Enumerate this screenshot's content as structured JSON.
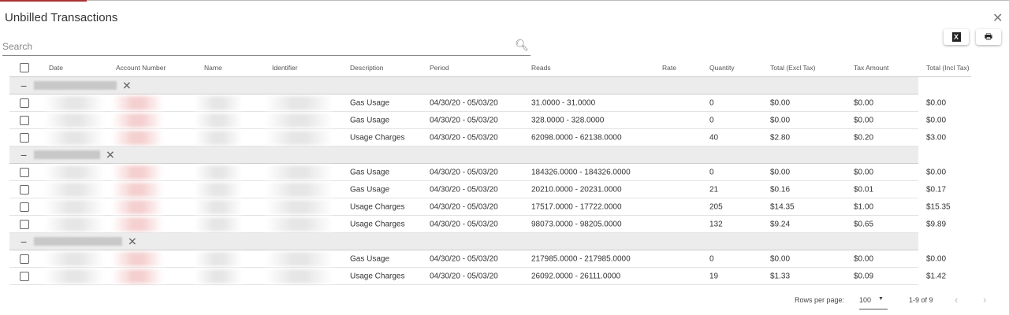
{
  "title": "Unbilled Transactions",
  "search": {
    "placeholder": "Search",
    "value": ""
  },
  "toolbar": {
    "export_excel_icon": "X",
    "print_icon": "print"
  },
  "columns": [
    "Date",
    "Account Number",
    "Name",
    "Identifier",
    "Description",
    "Period",
    "Reads",
    "Rate",
    "Quantity",
    "Total (Excl Tax)",
    "Tax Amount",
    "Total (Incl Tax)"
  ],
  "groups": [
    {
      "rows": [
        {
          "description": "Gas Usage",
          "period": "04/30/20 - 05/03/20",
          "reads": "31.0000 - 31.0000",
          "quantity": "0",
          "total_excl": "$0.00",
          "tax": "$0.00",
          "total_incl": "$0.00"
        },
        {
          "description": "Gas Usage",
          "period": "04/30/20 - 05/03/20",
          "reads": "328.0000 - 328.0000",
          "quantity": "0",
          "total_excl": "$0.00",
          "tax": "$0.00",
          "total_incl": "$0.00"
        },
        {
          "description": "Usage Charges",
          "period": "04/30/20 - 05/03/20",
          "reads": "62098.0000 - 62138.0000",
          "quantity": "40",
          "total_excl": "$2.80",
          "tax": "$0.20",
          "total_incl": "$3.00"
        }
      ]
    },
    {
      "rows": [
        {
          "description": "Gas Usage",
          "period": "04/30/20 - 05/03/20",
          "reads": "184326.0000 - 184326.0000",
          "quantity": "0",
          "total_excl": "$0.00",
          "tax": "$0.00",
          "total_incl": "$0.00"
        },
        {
          "description": "Gas Usage",
          "period": "04/30/20 - 05/03/20",
          "reads": "20210.0000 - 20231.0000",
          "quantity": "21",
          "total_excl": "$0.16",
          "tax": "$0.01",
          "total_incl": "$0.17"
        },
        {
          "description": "Usage Charges",
          "period": "04/30/20 - 05/03/20",
          "reads": "17517.0000 - 17722.0000",
          "quantity": "205",
          "total_excl": "$14.35",
          "tax": "$1.00",
          "total_incl": "$15.35"
        },
        {
          "description": "Usage Charges",
          "period": "04/30/20 - 05/03/20",
          "reads": "98073.0000 - 98205.0000",
          "quantity": "132",
          "total_excl": "$9.24",
          "tax": "$0.65",
          "total_incl": "$9.89"
        }
      ]
    },
    {
      "rows": [
        {
          "description": "Gas Usage",
          "period": "04/30/20 - 05/03/20",
          "reads": "217985.0000 - 217985.0000",
          "quantity": "0",
          "total_excl": "$0.00",
          "tax": "$0.00",
          "total_incl": "$0.00"
        },
        {
          "description": "Usage Charges",
          "period": "04/30/20 - 05/03/20",
          "reads": "26092.0000 - 26111.0000",
          "quantity": "19",
          "total_excl": "$1.33",
          "tax": "$0.09",
          "total_incl": "$1.42"
        }
      ]
    }
  ],
  "pagination": {
    "rows_per_page_label": "Rows per page:",
    "rows_per_page": "100",
    "range": "1-9 of 9"
  }
}
